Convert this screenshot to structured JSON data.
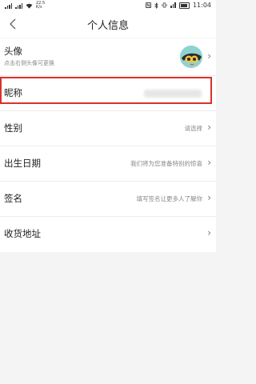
{
  "status_bar": {
    "netspeed_line1": "22.5",
    "netspeed_line2": "K/s",
    "time": "11:04"
  },
  "header": {
    "title": "个人信息"
  },
  "rows": {
    "avatar": {
      "label": "头像",
      "sub": "点击右侧头像可更换"
    },
    "nickname": {
      "label": "昵称"
    },
    "gender": {
      "label": "性别",
      "value": "请选择"
    },
    "birthday": {
      "label": "出生日期",
      "value": "我们将为您准备特别的惊喜"
    },
    "signature": {
      "label": "签名",
      "value": "填写签名让更多人了解你"
    },
    "address": {
      "label": "收货地址"
    }
  },
  "colors": {
    "highlight_border": "#d9322c",
    "avatar_bg": "#8fd3d0"
  }
}
